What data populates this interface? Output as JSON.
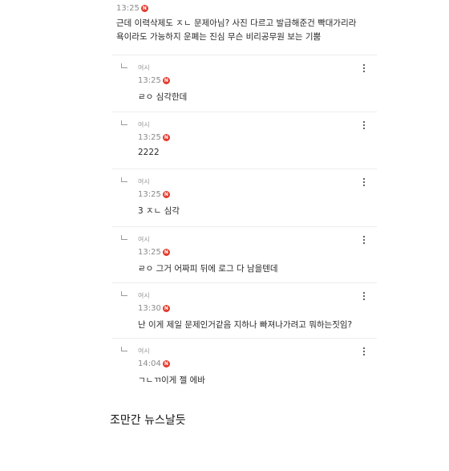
{
  "top_comment": {
    "time": "13:25",
    "badge": "N",
    "text": "근데 이력삭제도 ㅈㄴ 문제아님? 사진 다르고 발급해준건 빡대가리라\n욕이라도 가능하지 운폐는 진심 무슨 비리공무원 보는 기뿜"
  },
  "replies": [
    {
      "author": "여시",
      "time": "13:25",
      "badge": "N",
      "text": "ㄹㅇ 심각한데"
    },
    {
      "author": "여시",
      "time": "13:25",
      "badge": "N",
      "text": "2222"
    },
    {
      "author": "여시",
      "time": "13:25",
      "badge": "N",
      "text": "3 ㅈㄴ 심각"
    },
    {
      "author": "여시",
      "time": "13:25",
      "badge": "N",
      "text": "ㄹㅇ 그거 어짜피 뒤에 로그 다 남을텐데"
    },
    {
      "author": "여시",
      "time": "13:30",
      "badge": "N",
      "text": "난 이게 제일 문제인거같음 지하나 빠져나가려고 뭐하는짓임?"
    },
    {
      "author": "여시",
      "time": "14:04",
      "badge": "N",
      "text": "ㄱㄴㄲ이게 젤 에바"
    }
  ],
  "footer": {
    "text": "조만간 뉴스날듯"
  },
  "icons": {
    "reply": "reply-arrow-icon",
    "more": "more-options-icon",
    "new": "new-badge-icon"
  },
  "colors": {
    "new_badge": "#e23b2e",
    "meta_text": "#8a8a8a"
  }
}
